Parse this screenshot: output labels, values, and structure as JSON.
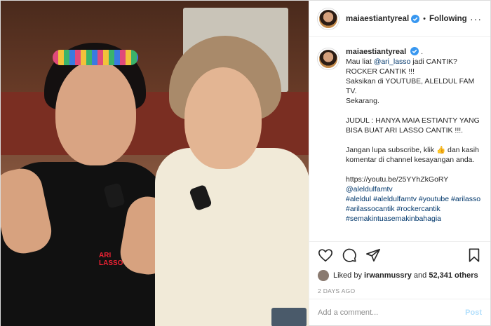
{
  "header": {
    "username": "maiaestiantyreal",
    "follow_state": "Following",
    "separator": "•",
    "more": "···"
  },
  "caption": {
    "username": "maiaestiantyreal",
    "trailing": ".",
    "lines": [
      "Mau liat ",
      "@ari_lasso",
      " jadi CANTIK?",
      "ROCKER CANTIK !!!",
      "Saksikan di YOUTUBE, ALELDUL FAM TV.",
      "Sekarang.",
      "JUDUL : HANYA MAIA ESTIANTY YANG BISA BUAT ARI LASSO CANTIK !!!.",
      "Jangan lupa subscribe, klik 👍 dan kasih komentar di channel kesayangan anda.",
      "https://youtu.be/25YYhZkGoRY",
      "@aleldulfamtv",
      "#aleldul #aleldulfamtv #youtube #arilasso #arilassocantik #rockercantik #semakintuasemakinbahagia"
    ]
  },
  "likes": {
    "prefix": "Liked by ",
    "user": "irwanmussry",
    "middle": " and ",
    "count": "52,341 others"
  },
  "time": "2 DAYS AGO",
  "comment": {
    "placeholder": "Add a comment...",
    "post_label": "Post"
  },
  "photo": {
    "shirt_logo": "ARI LASSO"
  },
  "colors": {
    "link": "#00376b",
    "verified": "#3897f0",
    "post_disabled": "#b2dffc"
  },
  "icons": [
    "verified-badge-icon",
    "heart-icon",
    "comment-icon",
    "share-icon",
    "bookmark-icon"
  ]
}
